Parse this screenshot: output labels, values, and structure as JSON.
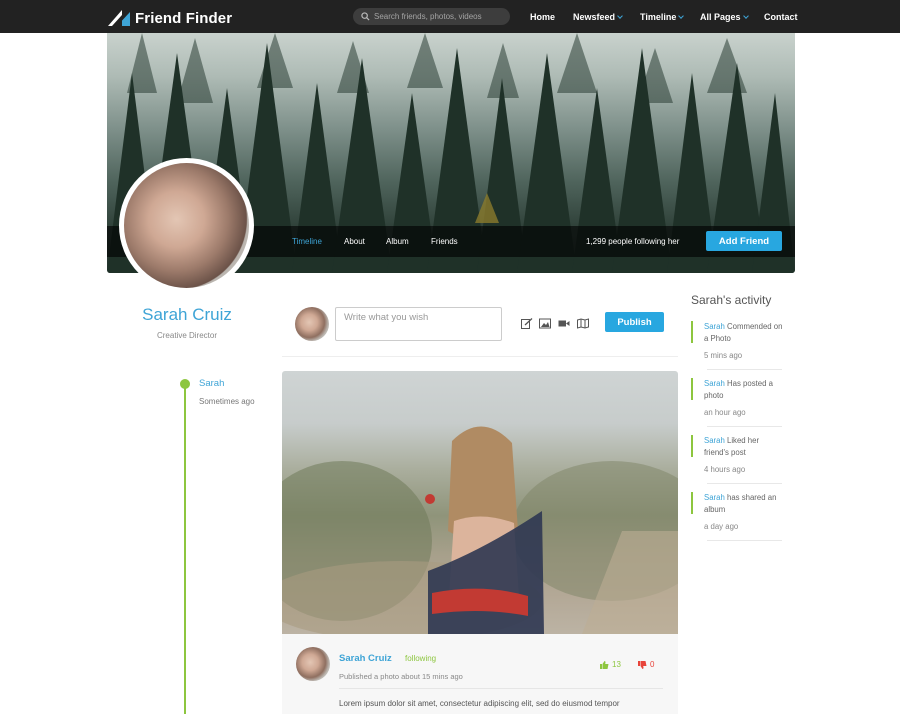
{
  "brand": {
    "name": "Friend Finder",
    "accent": "#3ea4d6",
    "green": "#8dc63f"
  },
  "search": {
    "placeholder": "Search friends, photos, videos"
  },
  "nav": [
    {
      "label": "Home",
      "has_dropdown": false
    },
    {
      "label": "Newsfeed",
      "has_dropdown": true
    },
    {
      "label": "Timeline",
      "has_dropdown": true
    },
    {
      "label": "All Pages",
      "has_dropdown": true
    },
    {
      "label": "Contact",
      "has_dropdown": false
    }
  ],
  "cover": {
    "tabs": [
      "Timeline",
      "About",
      "Album",
      "Friends"
    ],
    "active_tab": "Timeline",
    "followers": "1,299 people following her",
    "add_friend_label": "Add Friend"
  },
  "profile": {
    "name": "Sarah Cruiz",
    "role": "Creative Director"
  },
  "composer": {
    "placeholder": "Write what you wish",
    "tools": [
      "edit-icon",
      "image-icon",
      "video-icon",
      "map-icon"
    ],
    "publish_label": "Publish"
  },
  "timeline": {
    "name": "Sarah",
    "time": "Sometimes ago"
  },
  "post": {
    "author": "Sarah Cruiz",
    "following": "following",
    "meta": "Published a photo about 15 mins ago",
    "likes": "13",
    "dislikes": "0",
    "text": "Lorem ipsum dolor sit amet, consectetur adipiscing elit, sed do eiusmod tempor"
  },
  "activity": {
    "title": "Sarah's activity",
    "items": [
      {
        "who": "Sarah",
        "action": "Commended on a Photo",
        "time": "5 mins ago"
      },
      {
        "who": "Sarah",
        "action": "Has posted a photo",
        "time": "an hour ago"
      },
      {
        "who": "Sarah",
        "action": "Liked her friend's post",
        "time": "4 hours ago"
      },
      {
        "who": "Sarah",
        "action": "has shared an album",
        "time": "a day ago"
      }
    ]
  }
}
